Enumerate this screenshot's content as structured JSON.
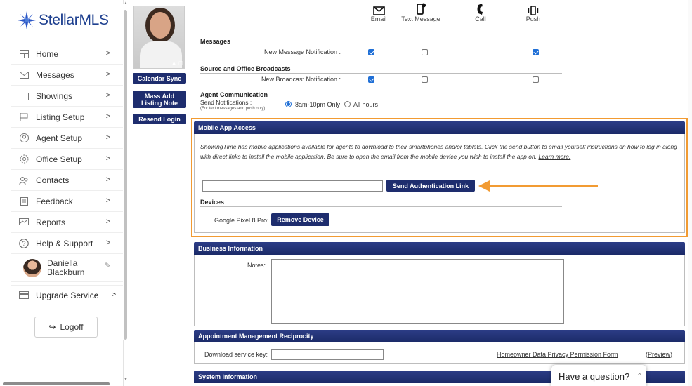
{
  "brand": {
    "name_part1": "Stellar",
    "name_part2": "MLS",
    "color": "#1d3f8f"
  },
  "sidebar": {
    "items": [
      {
        "label": "Home",
        "icon": "home-icon"
      },
      {
        "label": "Messages",
        "icon": "envelope-icon"
      },
      {
        "label": "Showings",
        "icon": "calendar-icon"
      },
      {
        "label": "Listing Setup",
        "icon": "flag-icon"
      },
      {
        "label": "Agent Setup",
        "icon": "agent-icon"
      },
      {
        "label": "Office Setup",
        "icon": "gear-icon"
      },
      {
        "label": "Contacts",
        "icon": "contacts-icon"
      },
      {
        "label": "Feedback",
        "icon": "clipboard-icon"
      },
      {
        "label": "Reports",
        "icon": "reports-icon"
      },
      {
        "label": "Help & Support",
        "icon": "help-icon"
      }
    ],
    "user": {
      "first": "Daniella",
      "last": "Blackburn"
    },
    "upgrade": "Upgrade Service",
    "logoff": "Logoff",
    "chevron": ">"
  },
  "profile_actions": {
    "calendar_sync": "Calendar Sync",
    "mass_add_line1": "Mass Add",
    "mass_add_line2": "Listing Note",
    "resend_login": "Resend Login"
  },
  "notifications": {
    "channels": [
      {
        "label": "Email",
        "icon": "envelope-icon"
      },
      {
        "label": "Text Message",
        "icon": "text-message-icon"
      },
      {
        "label": "Call",
        "icon": "phone-icon"
      },
      {
        "label": "Push",
        "icon": "push-icon"
      }
    ],
    "messages_title": "Messages",
    "new_message_label": "New Message Notification :",
    "new_message_checks": [
      true,
      false,
      true
    ],
    "broadcasts_title": "Source and Office Broadcasts",
    "new_broadcast_label": "New Broadcast Notification :",
    "new_broadcast_checks": [
      true,
      false,
      false
    ],
    "agent_comm_title": "Agent Communication",
    "send_label": "Send Notifications :",
    "send_note": "(For text messages and push only)",
    "option_limited": "8am-10pm Only",
    "option_all": "All hours",
    "selected": "limited"
  },
  "mobile_app": {
    "title": "Mobile App Access",
    "intro": "ShowingTime has mobile applications available for agents to download to their smartphones and/or tablets. Click the send button to email yourself instructions on how to log in along with direct links to install the mobile application. Be sure to open the email from the mobile device you wish to install the app on.",
    "learn_more": "Learn more.",
    "send_button": "Send Authentication Link",
    "devices_title": "Devices",
    "device_name": "Google Pixel 8 Pro:",
    "remove_button": "Remove Device",
    "highlight_color": "#f29b32"
  },
  "business": {
    "title": "Business Information",
    "notes_label": "Notes:"
  },
  "reciprocity": {
    "title": "Appointment Management Reciprocity",
    "download_label": "Download service key:",
    "privacy_link": "Homeowner Data Privacy Permission Form",
    "preview_link": "(Preview)"
  },
  "system": {
    "title": "System Information"
  },
  "chat": {
    "label": "Have a question?"
  },
  "header_color": "#1e2d6e"
}
